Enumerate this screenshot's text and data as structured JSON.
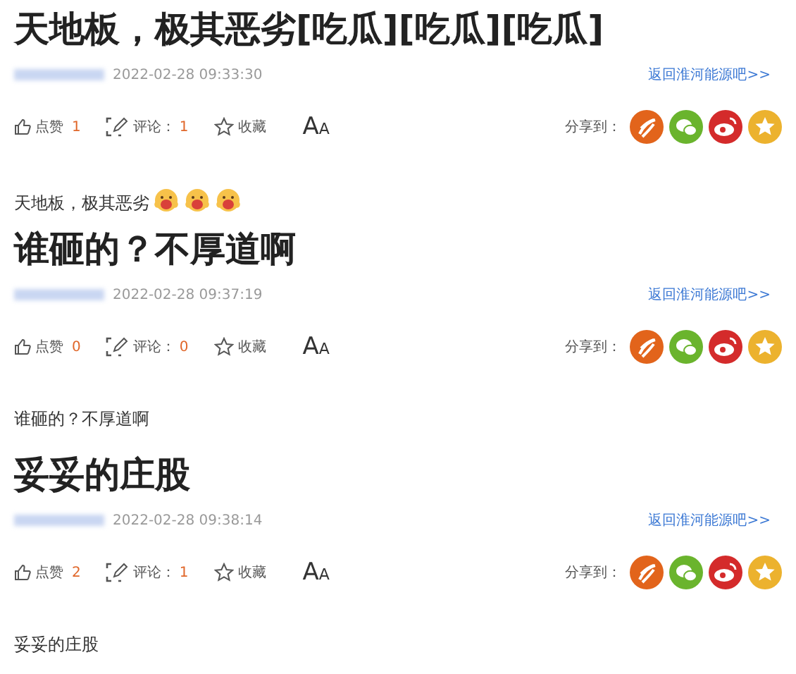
{
  "posts": [
    {
      "title": "天地板，极其恶劣[吃瓜][吃瓜][吃瓜]",
      "time": "2022-02-28 09:33:30",
      "back_link": "返回淮河能源吧>>",
      "like": {
        "label": "点赞",
        "count": "1"
      },
      "comment": {
        "label": "评论：",
        "count": "1"
      },
      "favorite": {
        "label": "收藏"
      },
      "font_size": {
        "large": "A",
        "small": "A"
      },
      "share_label": "分享到：",
      "body": "天地板，极其恶劣",
      "stickers": [
        {
          "kind": "face"
        },
        {
          "kind": "face"
        },
        {
          "kind": "face"
        }
      ]
    },
    {
      "title": "谁砸的？不厚道啊",
      "time": "2022-02-28 09:37:19",
      "back_link": "返回淮河能源吧>>",
      "like": {
        "label": "点赞",
        "count": "0"
      },
      "comment": {
        "label": "评论：",
        "count": "0"
      },
      "favorite": {
        "label": "收藏"
      },
      "font_size": {
        "large": "A",
        "small": "A"
      },
      "share_label": "分享到：",
      "body": "谁砸的？不厚道啊"
    },
    {
      "title": "妥妥的庄股",
      "time": "2022-02-28 09:38:14",
      "back_link": "返回淮河能源吧>>",
      "like": {
        "label": "点赞",
        "count": "2"
      },
      "comment": {
        "label": "评论：",
        "count": "1"
      },
      "favorite": {
        "label": "收藏"
      },
      "font_size": {
        "large": "A",
        "small": "A"
      },
      "share_label": "分享到：",
      "body": "妥妥的庄股"
    }
  ]
}
